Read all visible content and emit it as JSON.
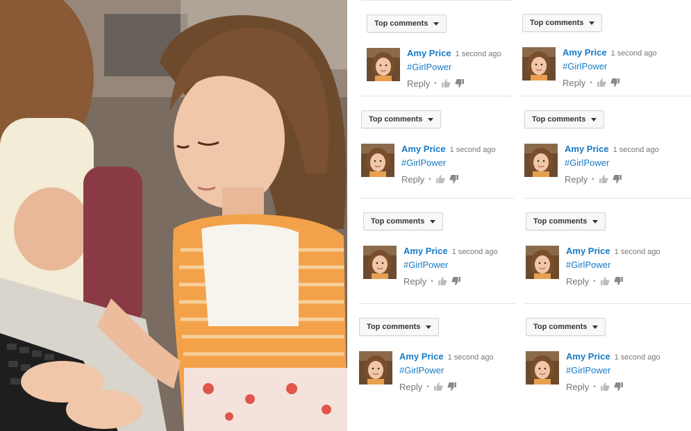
{
  "photo": {
    "alt": ""
  },
  "comments": [
    {
      "sort_label": "Top comments",
      "author": "Amy Price",
      "time": "1 second ago",
      "text": "#GirlPower",
      "reply": "Reply",
      "dot": "•"
    },
    {
      "sort_label": "Top comments",
      "author": "Amy Price",
      "time": "1 second ago",
      "text": "#GirlPower",
      "reply": "Reply",
      "dot": "•"
    },
    {
      "sort_label": "Top comments",
      "author": "Amy Price",
      "time": "1 second ago",
      "text": "#GirlPower",
      "reply": "Reply",
      "dot": "•"
    },
    {
      "sort_label": "Top comments",
      "author": "Amy Price",
      "time": "1 second ago",
      "text": "#GirlPower",
      "reply": "Reply",
      "dot": "•"
    },
    {
      "sort_label": "Top comments",
      "author": "Amy Price",
      "time": "1 second ago",
      "text": "#GirlPower",
      "reply": "Reply",
      "dot": "•"
    },
    {
      "sort_label": "Top comments",
      "author": "Amy Price",
      "time": "1 second ago",
      "text": "#GirlPower",
      "reply": "Reply",
      "dot": "•"
    },
    {
      "sort_label": "Top comments",
      "author": "Amy Price",
      "time": "1 second ago",
      "text": "#GirlPower",
      "reply": "Reply",
      "dot": "•"
    },
    {
      "sort_label": "Top comments",
      "author": "Amy Price",
      "time": "1 second ago",
      "text": "#GirlPower",
      "reply": "Reply",
      "dot": "•"
    }
  ],
  "colors": {
    "link": "#167ac6",
    "meta": "#767676",
    "divider": "#e3e3e3"
  }
}
